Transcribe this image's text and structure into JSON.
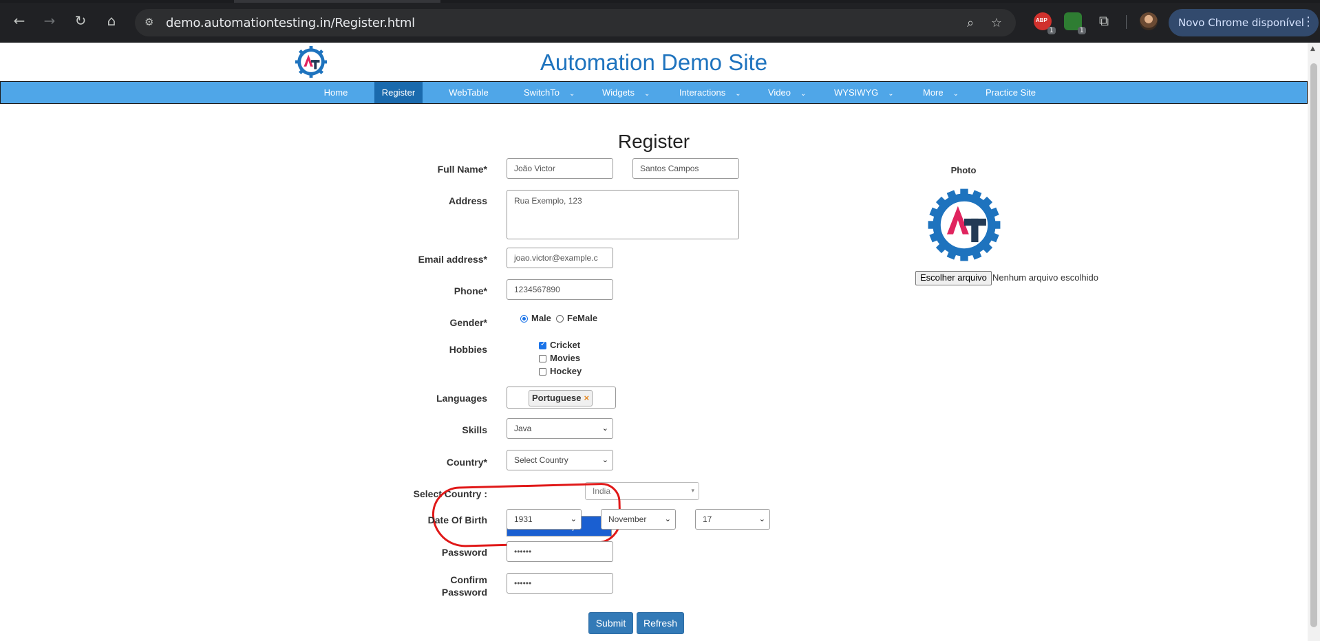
{
  "browser": {
    "url": "demo.automationtesting.in/Register.html",
    "update_label": "Novo Chrome disponível",
    "ext_badge_1": "1",
    "ext_badge_2": "1",
    "abp_label": "ABP"
  },
  "site": {
    "title": "Automation Demo Site"
  },
  "nav": {
    "items": [
      {
        "label": "Home"
      },
      {
        "label": "Register"
      },
      {
        "label": "WebTable"
      },
      {
        "label": "SwitchTo"
      },
      {
        "label": "Widgets"
      },
      {
        "label": "Interactions"
      },
      {
        "label": "Video"
      },
      {
        "label": "WYSIWYG"
      },
      {
        "label": "More"
      },
      {
        "label": "Practice Site"
      }
    ],
    "active": "Register"
  },
  "form": {
    "heading": "Register",
    "full_name_label": "Full Name*",
    "first_name": "João Victor",
    "last_name": "Santos Campos",
    "address_label": "Address",
    "address": "Rua Exemplo, 123",
    "email_label": "Email address*",
    "email": "joao.victor@example.c",
    "phone_label": "Phone*",
    "phone": "1234567890",
    "gender_label": "Gender*",
    "gender_male": "Male",
    "gender_female": "FeMale",
    "hobbies_label": "Hobbies",
    "hobby_cricket": "Cricket",
    "hobby_movies": "Movies",
    "hobby_hockey": "Hockey",
    "languages_label": "Languages",
    "language_tag": "Portuguese",
    "skills_label": "Skills",
    "skills_value": "Java",
    "country_label": "Country*",
    "country_value": "Select Country",
    "country_option": "Select Country",
    "select_country_label": "Select Country :",
    "select_country_value": "India",
    "dob_label": "Date Of Birth",
    "dob_year": "1931",
    "dob_month": "November",
    "dob_day": "17",
    "password_label": "Password",
    "password_value": "••••••",
    "confirm_label_1": "Confirm",
    "confirm_label_2": "Password",
    "confirm_value": "••••••",
    "submit_label": "Submit",
    "refresh_label": "Refresh"
  },
  "photo": {
    "label": "Photo",
    "choose_file": "Escolher arquivo",
    "no_file": "Nenhum arquivo escolhido"
  },
  "colors": {
    "nav_bg": "#4fa6e8",
    "nav_active": "#1a6aad",
    "title_blue": "#1e73be",
    "button_blue": "#337ab7",
    "annotation_red": "#e01818"
  }
}
